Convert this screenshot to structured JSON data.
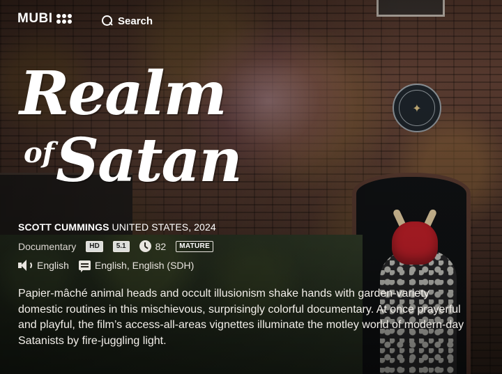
{
  "header": {
    "logo_text": "MUBI",
    "search_label": "Search"
  },
  "film": {
    "title_line1": "Realm",
    "title_of": "of",
    "title_line2": "Satan",
    "director": "SCOTT CUMMINGS",
    "country_year": "UNITED STATES, 2024",
    "genre": "Documentary",
    "video_badge": "HD",
    "audio_badge": "5.1",
    "runtime": "82",
    "rating": "MATURE",
    "audio_language": "English",
    "subtitles": "English, English (SDH)",
    "synopsis": "Papier-mâché animal heads and occult illusionism shake hands with garden-variety domestic routines in this mischievous, surprisingly colorful documentary. At once prayerful and playful, the film’s access-all-areas vignettes illuminate the motley world of modern-day Satanists by fire-juggling light."
  },
  "icons": {
    "search": "search-icon",
    "clock": "clock-icon",
    "speaker": "speaker-icon",
    "subtitles": "subtitles-icon"
  },
  "colors": {
    "text": "#ffffff",
    "badge_bg": "#eae6e0"
  }
}
